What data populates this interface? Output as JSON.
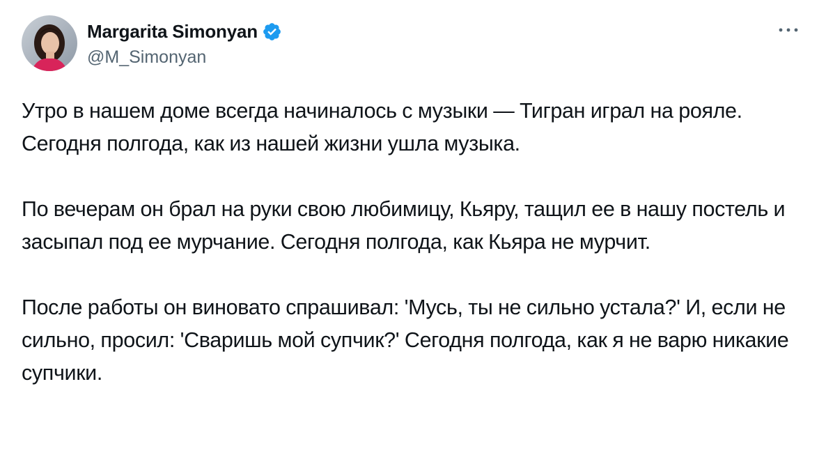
{
  "author": {
    "display_name": "Margarita Simonyan",
    "handle": "@M_Simonyan",
    "verified": true
  },
  "icons": {
    "verified": "verified-badge-icon",
    "more": "more-horizontal-icon"
  },
  "colors": {
    "verified_blue": "#1d9bf0",
    "text": "#0f1419",
    "secondary_text": "#536471"
  },
  "tweet": {
    "paragraphs": [
      "Утро в нашем доме всегда начиналось с музыки — Тигран играл на рояле. Сегодня полгода, как из нашей жизни ушла музыка.",
      "По вечерам он брал на руки свою любимицу, Кьяру, тащил ее в нашу постель и засыпал под ее мурчание. Сегодня полгода, как Кьяра не мурчит.",
      "После работы он виновато спрашивал: 'Мусь, ты не сильно устала?' И, если не сильно, просил: 'Сваришь мой супчик?' Сегодня полгода, как я не варю никакие супчики."
    ]
  }
}
